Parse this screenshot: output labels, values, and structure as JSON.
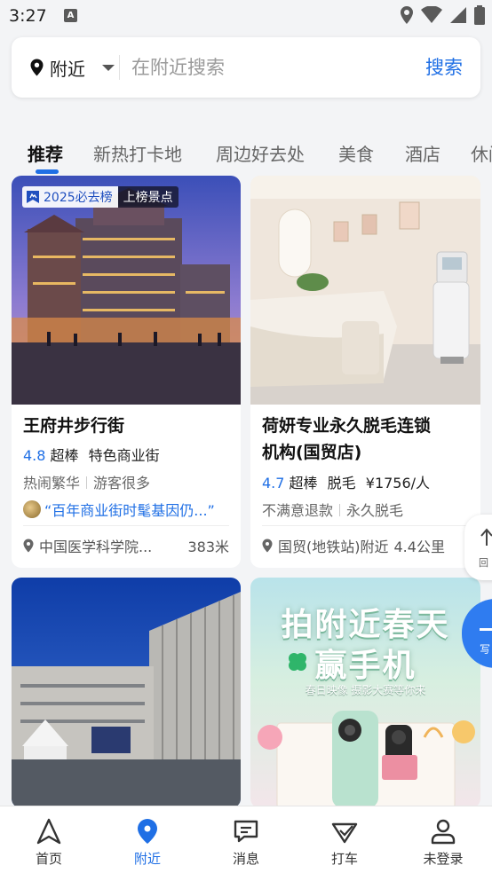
{
  "status_bar": {
    "time": "3:27",
    "notification_glyph": "A"
  },
  "search": {
    "location_label": "附近",
    "placeholder": "在附近搜索",
    "button_label": "搜索"
  },
  "tabs": [
    {
      "label": "推荐",
      "active": true
    },
    {
      "label": "新热打卡地"
    },
    {
      "label": "周边好去处"
    },
    {
      "label": "美食"
    },
    {
      "label": "酒店"
    },
    {
      "label": "休闲"
    }
  ],
  "cards": [
    {
      "badge_rank": "2025必去榜",
      "badge_tag": "上榜景点",
      "title": "王府井步行街",
      "score": "4.8",
      "rating_label": "超棒",
      "category": "特色商业街",
      "tag1": "热闹繁华",
      "tag2": "游客很多",
      "quote": "“百年商业街时髦基因仍...”",
      "place": "中国医学科学院...",
      "distance": "383米"
    },
    {
      "title_line1": "荷妍专业永久脱毛连锁",
      "title_line2": "机构(国贸店)",
      "score": "4.7",
      "rating_label": "超棒",
      "category": "脱毛",
      "price": "¥1756/人",
      "tag1": "不满意退款",
      "tag2": "永久脱毛",
      "place": "国贸(地铁站)附近",
      "distance": "4.4公里"
    },
    {
      "headline1": "拍附近春天",
      "headline2": "赢手机",
      "subline": "春日映像 摄影大赛等你来"
    }
  ],
  "floats": {
    "top_label": "回",
    "write_label": "写"
  },
  "bottom_nav": [
    {
      "label": "首页",
      "icon": "navigate-arrow-icon"
    },
    {
      "label": "附近",
      "icon": "location-pin-icon",
      "active": true
    },
    {
      "label": "消息",
      "icon": "message-icon"
    },
    {
      "label": "打车",
      "icon": "taxi-icon"
    },
    {
      "label": "未登录",
      "icon": "user-icon"
    }
  ],
  "colors": {
    "accent": "#1f6fe5",
    "background": "#f3f4f6"
  }
}
